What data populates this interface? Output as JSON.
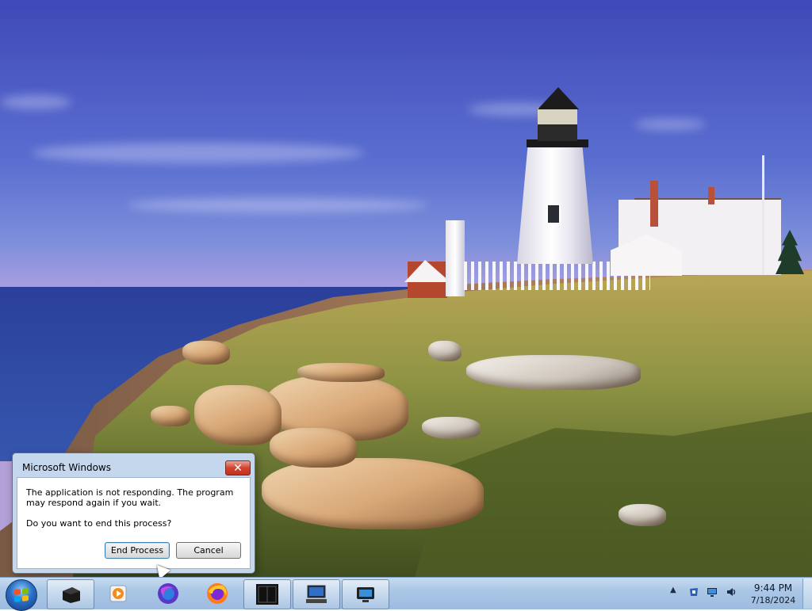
{
  "dialog": {
    "title": "Microsoft Windows",
    "close_glyph": "✕",
    "message_line1": "The application is not responding. The program may respond again if you wait.",
    "message_line2": "Do you want to end this process?",
    "end_process_label": "End Process",
    "cancel_label": "Cancel"
  },
  "taskbar": {
    "items": [
      {
        "icon": "media-device-icon"
      },
      {
        "icon": "media-player-icon"
      },
      {
        "icon": "firefox-nightly-icon"
      },
      {
        "icon": "firefox-icon"
      },
      {
        "icon": "terminal-icon"
      },
      {
        "icon": "computer-icon"
      },
      {
        "icon": "monitor-icon"
      }
    ],
    "tray": {
      "show_hidden_glyph": "▲",
      "icons": [
        "action-center-icon",
        "network-icon",
        "volume-icon"
      ]
    },
    "clock": {
      "time": "9:44 PM",
      "date": "7/18/2024"
    }
  },
  "colors": {
    "taskbar": "#aac7e6",
    "dialog_frame": "#c5d7ec",
    "close_button": "#d2432f",
    "default_button_border": "#3c7fb1"
  }
}
